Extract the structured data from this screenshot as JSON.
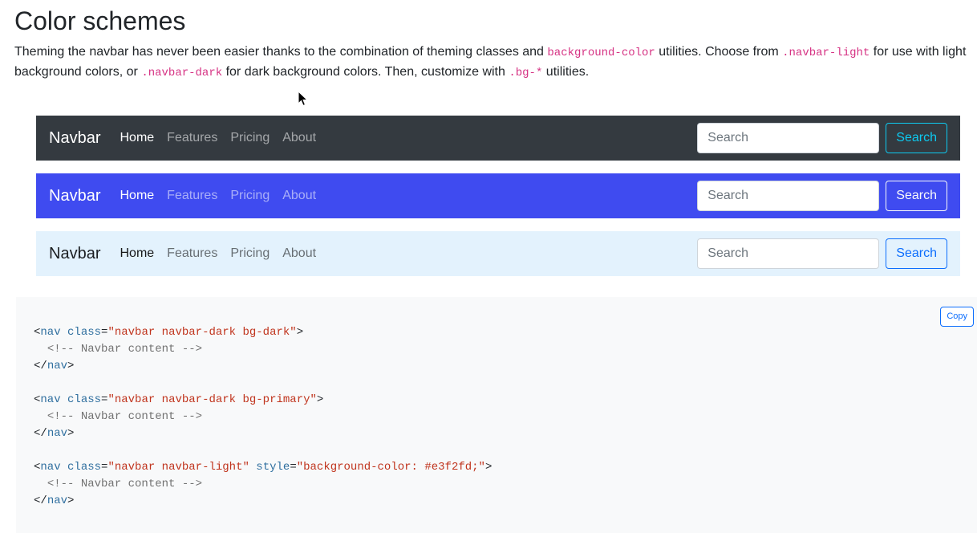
{
  "heading": "Color schemes",
  "intro": {
    "part1": "Theming the navbar has never been easier thanks to the combination of theming classes and ",
    "code1": "background-color",
    "part2": " utilities. Choose from ",
    "code2": ".navbar-light",
    "part3": " for use with light background colors, or ",
    "code3": ".navbar-dark",
    "part4": " for dark background colors. Then, customize with ",
    "code4": ".bg-*",
    "part5": " utilities."
  },
  "navbars": [
    {
      "brand": "Navbar",
      "links": [
        "Home",
        "Features",
        "Pricing",
        "About"
      ],
      "search_placeholder": "Search",
      "search_button": "Search",
      "bg": "#343a40"
    },
    {
      "brand": "Navbar",
      "links": [
        "Home",
        "Features",
        "Pricing",
        "About"
      ],
      "search_placeholder": "Search",
      "search_button": "Search",
      "bg": "#3f4bf0"
    },
    {
      "brand": "Navbar",
      "links": [
        "Home",
        "Features",
        "Pricing",
        "About"
      ],
      "search_placeholder": "Search",
      "search_button": "Search",
      "bg": "#e3f2fd"
    }
  ],
  "code": {
    "copy_label": "Copy",
    "blocks": [
      {
        "open_tag": "nav",
        "attr1": "class",
        "val1": "\"navbar navbar-dark bg-dark\"",
        "comment": "<!-- Navbar content -->",
        "close_tag": "nav"
      },
      {
        "open_tag": "nav",
        "attr1": "class",
        "val1": "\"navbar navbar-dark bg-primary\"",
        "comment": "<!-- Navbar content -->",
        "close_tag": "nav"
      },
      {
        "open_tag": "nav",
        "attr1": "class",
        "val1": "\"navbar navbar-light\"",
        "attr2": "style",
        "val2": "\"background-color: #e3f2fd;\"",
        "comment": "<!-- Navbar content -->",
        "close_tag": "nav"
      }
    ]
  }
}
